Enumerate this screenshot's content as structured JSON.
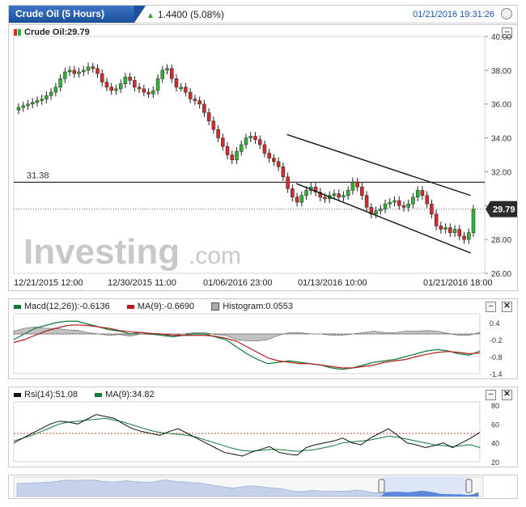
{
  "header": {
    "tab_label": "Crude Oil (5 Hours)",
    "change": "1.4400 (5.08%)",
    "timestamp": "01/21/2016 19:31:26"
  },
  "main": {
    "legend": "Crude Oil:29.79",
    "level_label": "31.38",
    "price_badge": "29.79",
    "watermark": "Investing",
    "watermark_suffix": ".com"
  },
  "macd": {
    "macd_label": "Macd(12,26)):-0.6136",
    "ma_label": "MA(9):-0.6690",
    "hist_label": "Histogram:0.0553"
  },
  "rsi": {
    "rsi_label": "Rsi(14):51.08",
    "ma_label": "MA(9):34.82"
  },
  "colors": {
    "up": "#33b233",
    "down": "#d42b2b",
    "macd": "#0e7a3a",
    "signal": "#b01e1e",
    "navigator": "#3b6fd4"
  },
  "chart_data": [
    {
      "type": "candlestick",
      "title": "Crude Oil (5 Hours)",
      "x_ticks": [
        "12/21/2015 12:00",
        "12/30/2015 11:00",
        "01/06/2016 23:00",
        "01/13/2016 10:00",
        "01/21/2016 18:00"
      ],
      "y_ticks": [
        "40.00",
        "38.00",
        "36.00",
        "34.00",
        "32.00",
        "30.00",
        "28.00",
        "26.00"
      ],
      "ylim": [
        26,
        40
      ],
      "close": [
        35.8,
        35.9,
        36.0,
        36.1,
        36.2,
        36.3,
        36.5,
        36.7,
        37.0,
        37.5,
        37.9,
        38.0,
        37.8,
        37.9,
        38.0,
        38.2,
        38.1,
        37.8,
        37.3,
        37.0,
        36.8,
        36.9,
        37.2,
        37.6,
        37.4,
        37.0,
        36.9,
        36.7,
        36.6,
        36.8,
        37.5,
        38.0,
        38.1,
        37.5,
        37.0,
        37.0,
        36.7,
        36.3,
        36.2,
        36.0,
        35.5,
        35.0,
        34.5,
        34.0,
        33.5,
        33.0,
        32.7,
        33.2,
        33.6,
        34.0,
        34.1,
        33.9,
        33.6,
        33.1,
        32.8,
        32.6,
        32.3,
        31.7,
        31.0,
        30.5,
        30.2,
        30.6,
        30.9,
        31.1,
        30.8,
        30.5,
        30.4,
        30.6,
        30.7,
        30.5,
        30.6,
        30.9,
        31.4,
        31.1,
        30.6,
        29.9,
        29.5,
        29.7,
        29.8,
        30.1,
        30.2,
        30.3,
        30.0,
        29.9,
        30.1,
        30.5,
        30.9,
        30.6,
        30.1,
        29.5,
        28.8,
        28.6,
        28.7,
        28.4,
        28.6,
        28.2,
        28.0,
        28.4,
        29.79
      ],
      "level": 31.38,
      "last_price": 29.79,
      "channel_upper": [
        [
          0.58,
          34.2
        ],
        [
          0.97,
          30.6
        ]
      ],
      "channel_lower": [
        [
          0.6,
          31.3
        ],
        [
          0.97,
          27.2
        ]
      ]
    },
    {
      "type": "line",
      "title": "Macd(12,26))",
      "y_ticks": [
        "0.4",
        "-0.2",
        "-0.8",
        "-1.4"
      ],
      "ylim": [
        -1.4,
        0.6
      ],
      "series": [
        {
          "name": "Macd(12,26))",
          "values": [
            -0.2,
            0.0,
            0.2,
            0.3,
            0.4,
            0.45,
            0.45,
            0.35,
            0.25,
            0.15,
            0.1,
            0.0,
            0.05,
            0.0,
            -0.05,
            -0.1,
            -0.05,
            0.0,
            0.0,
            -0.1,
            -0.2,
            -0.45,
            -0.7,
            -0.9,
            -1.05,
            -1.0,
            -0.95,
            -1.0,
            -1.05,
            -1.1,
            -1.2,
            -1.25,
            -1.2,
            -1.1,
            -1.0,
            -0.95,
            -0.9,
            -0.8,
            -0.7,
            -0.6,
            -0.55,
            -0.6,
            -0.7,
            -0.75,
            -0.6
          ]
        },
        {
          "name": "MA(9)",
          "values": [
            -0.3,
            -0.2,
            -0.05,
            0.1,
            0.2,
            0.3,
            0.32,
            0.3,
            0.25,
            0.2,
            0.12,
            0.08,
            0.05,
            0.02,
            0.0,
            -0.05,
            -0.05,
            -0.05,
            -0.05,
            -0.08,
            -0.15,
            -0.25,
            -0.45,
            -0.65,
            -0.85,
            -0.95,
            -1.0,
            -1.05,
            -1.05,
            -1.1,
            -1.15,
            -1.2,
            -1.2,
            -1.15,
            -1.1,
            -1.0,
            -0.95,
            -0.9,
            -0.8,
            -0.72,
            -0.65,
            -0.62,
            -0.65,
            -0.7,
            -0.67
          ]
        },
        {
          "name": "Histogram",
          "values": [
            0.1,
            0.2,
            0.25,
            0.2,
            0.2,
            0.15,
            0.13,
            0.05,
            0.0,
            -0.05,
            -0.02,
            -0.08,
            0.0,
            -0.02,
            -0.05,
            -0.05,
            0.0,
            0.05,
            0.05,
            -0.02,
            -0.05,
            -0.2,
            -0.25,
            -0.25,
            -0.2,
            -0.05,
            0.05,
            0.05,
            0.0,
            0.0,
            -0.05,
            -0.05,
            0.0,
            0.05,
            0.1,
            0.05,
            0.05,
            0.1,
            0.1,
            0.12,
            0.1,
            0.02,
            -0.05,
            -0.05,
            0.06
          ]
        }
      ]
    },
    {
      "type": "line",
      "title": "Rsi(14)",
      "y_ticks": [
        "80",
        "60",
        "40",
        "20"
      ],
      "ylim": [
        20,
        80
      ],
      "level": 50,
      "series": [
        {
          "name": "Rsi(14)",
          "values": [
            40,
            45,
            50,
            55,
            60,
            63,
            62,
            60,
            65,
            70,
            68,
            66,
            60,
            55,
            52,
            50,
            48,
            52,
            55,
            50,
            45,
            40,
            35,
            30,
            28,
            26,
            30,
            33,
            36,
            30,
            28,
            27,
            35,
            38,
            40,
            42,
            45,
            40,
            38,
            45,
            50,
            55,
            48,
            40,
            38,
            35,
            37,
            40,
            35,
            40,
            45,
            51
          ]
        },
        {
          "name": "MA(9)",
          "values": [
            42,
            45,
            48,
            52,
            56,
            60,
            62,
            63,
            64,
            65,
            66,
            64,
            62,
            59,
            56,
            53,
            51,
            50,
            49,
            48,
            46,
            43,
            40,
            37,
            34,
            32,
            31,
            32,
            33,
            33,
            32,
            31,
            32,
            33,
            35,
            37,
            40,
            41,
            42,
            43,
            45,
            47,
            46,
            44,
            42,
            40,
            38,
            37,
            36,
            37,
            38,
            35
          ]
        }
      ]
    }
  ]
}
